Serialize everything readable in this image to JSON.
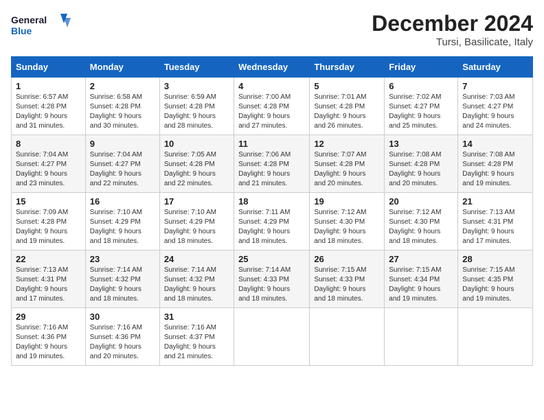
{
  "header": {
    "logo_general": "General",
    "logo_blue": "Blue",
    "month_year": "December 2024",
    "location": "Tursi, Basilicate, Italy"
  },
  "days_of_week": [
    "Sunday",
    "Monday",
    "Tuesday",
    "Wednesday",
    "Thursday",
    "Friday",
    "Saturday"
  ],
  "weeks": [
    [
      {
        "day": "1",
        "info": "Sunrise: 6:57 AM\nSunset: 4:28 PM\nDaylight: 9 hours\nand 31 minutes."
      },
      {
        "day": "2",
        "info": "Sunrise: 6:58 AM\nSunset: 4:28 PM\nDaylight: 9 hours\nand 30 minutes."
      },
      {
        "day": "3",
        "info": "Sunrise: 6:59 AM\nSunset: 4:28 PM\nDaylight: 9 hours\nand 28 minutes."
      },
      {
        "day": "4",
        "info": "Sunrise: 7:00 AM\nSunset: 4:28 PM\nDaylight: 9 hours\nand 27 minutes."
      },
      {
        "day": "5",
        "info": "Sunrise: 7:01 AM\nSunset: 4:28 PM\nDaylight: 9 hours\nand 26 minutes."
      },
      {
        "day": "6",
        "info": "Sunrise: 7:02 AM\nSunset: 4:27 PM\nDaylight: 9 hours\nand 25 minutes."
      },
      {
        "day": "7",
        "info": "Sunrise: 7:03 AM\nSunset: 4:27 PM\nDaylight: 9 hours\nand 24 minutes."
      }
    ],
    [
      {
        "day": "8",
        "info": "Sunrise: 7:04 AM\nSunset: 4:27 PM\nDaylight: 9 hours\nand 23 minutes."
      },
      {
        "day": "9",
        "info": "Sunrise: 7:04 AM\nSunset: 4:27 PM\nDaylight: 9 hours\nand 22 minutes."
      },
      {
        "day": "10",
        "info": "Sunrise: 7:05 AM\nSunset: 4:28 PM\nDaylight: 9 hours\nand 22 minutes."
      },
      {
        "day": "11",
        "info": "Sunrise: 7:06 AM\nSunset: 4:28 PM\nDaylight: 9 hours\nand 21 minutes."
      },
      {
        "day": "12",
        "info": "Sunrise: 7:07 AM\nSunset: 4:28 PM\nDaylight: 9 hours\nand 20 minutes."
      },
      {
        "day": "13",
        "info": "Sunrise: 7:08 AM\nSunset: 4:28 PM\nDaylight: 9 hours\nand 20 minutes."
      },
      {
        "day": "14",
        "info": "Sunrise: 7:08 AM\nSunset: 4:28 PM\nDaylight: 9 hours\nand 19 minutes."
      }
    ],
    [
      {
        "day": "15",
        "info": "Sunrise: 7:09 AM\nSunset: 4:28 PM\nDaylight: 9 hours\nand 19 minutes."
      },
      {
        "day": "16",
        "info": "Sunrise: 7:10 AM\nSunset: 4:29 PM\nDaylight: 9 hours\nand 18 minutes."
      },
      {
        "day": "17",
        "info": "Sunrise: 7:10 AM\nSunset: 4:29 PM\nDaylight: 9 hours\nand 18 minutes."
      },
      {
        "day": "18",
        "info": "Sunrise: 7:11 AM\nSunset: 4:29 PM\nDaylight: 9 hours\nand 18 minutes."
      },
      {
        "day": "19",
        "info": "Sunrise: 7:12 AM\nSunset: 4:30 PM\nDaylight: 9 hours\nand 18 minutes."
      },
      {
        "day": "20",
        "info": "Sunrise: 7:12 AM\nSunset: 4:30 PM\nDaylight: 9 hours\nand 18 minutes."
      },
      {
        "day": "21",
        "info": "Sunrise: 7:13 AM\nSunset: 4:31 PM\nDaylight: 9 hours\nand 17 minutes."
      }
    ],
    [
      {
        "day": "22",
        "info": "Sunrise: 7:13 AM\nSunset: 4:31 PM\nDaylight: 9 hours\nand 17 minutes."
      },
      {
        "day": "23",
        "info": "Sunrise: 7:14 AM\nSunset: 4:32 PM\nDaylight: 9 hours\nand 18 minutes."
      },
      {
        "day": "24",
        "info": "Sunrise: 7:14 AM\nSunset: 4:32 PM\nDaylight: 9 hours\nand 18 minutes."
      },
      {
        "day": "25",
        "info": "Sunrise: 7:14 AM\nSunset: 4:33 PM\nDaylight: 9 hours\nand 18 minutes."
      },
      {
        "day": "26",
        "info": "Sunrise: 7:15 AM\nSunset: 4:33 PM\nDaylight: 9 hours\nand 18 minutes."
      },
      {
        "day": "27",
        "info": "Sunrise: 7:15 AM\nSunset: 4:34 PM\nDaylight: 9 hours\nand 19 minutes."
      },
      {
        "day": "28",
        "info": "Sunrise: 7:15 AM\nSunset: 4:35 PM\nDaylight: 9 hours\nand 19 minutes."
      }
    ],
    [
      {
        "day": "29",
        "info": "Sunrise: 7:16 AM\nSunset: 4:36 PM\nDaylight: 9 hours\nand 19 minutes."
      },
      {
        "day": "30",
        "info": "Sunrise: 7:16 AM\nSunset: 4:36 PM\nDaylight: 9 hours\nand 20 minutes."
      },
      {
        "day": "31",
        "info": "Sunrise: 7:16 AM\nSunset: 4:37 PM\nDaylight: 9 hours\nand 21 minutes."
      },
      null,
      null,
      null,
      null
    ]
  ]
}
